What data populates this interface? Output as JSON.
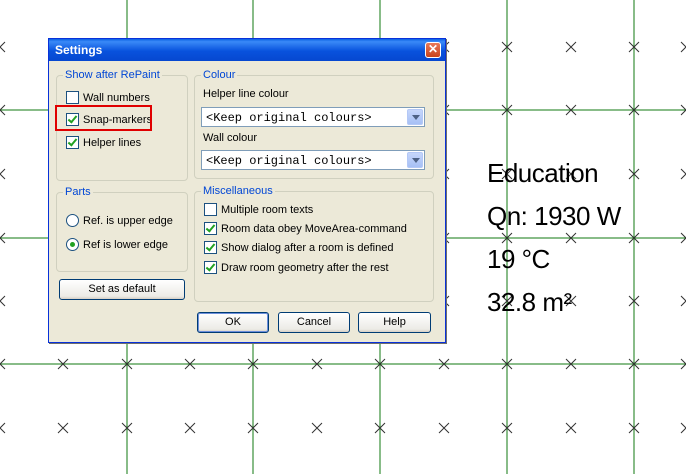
{
  "dialog": {
    "title": "Settings",
    "close_glyph": "✕",
    "show_after_repaint": {
      "legend": "Show after RePaint",
      "items": [
        {
          "label": "Wall numbers",
          "checked": false
        },
        {
          "label": "Snap-markers",
          "checked": true
        },
        {
          "label": "Helper lines",
          "checked": true
        }
      ]
    },
    "parts": {
      "legend": "Parts",
      "options": [
        {
          "label": "Ref. is upper edge",
          "selected": false
        },
        {
          "label": "Ref is lower edge",
          "selected": true
        }
      ]
    },
    "set_default_label": "Set as default",
    "colour": {
      "legend": "Colour",
      "helper_label": "Helper line colour",
      "helper_value": "<Keep original colours>",
      "wall_label": "Wall colour",
      "wall_value": "<Keep original colours>"
    },
    "misc": {
      "legend": "Miscellaneous",
      "items": [
        {
          "label": "Multiple room texts",
          "checked": false
        },
        {
          "label": "Room data obey MoveArea-command",
          "checked": true
        },
        {
          "label": "Show dialog after a room is defined",
          "checked": true
        },
        {
          "label": "Draw room geometry after the rest",
          "checked": true
        }
      ]
    },
    "buttons": {
      "ok": "OK",
      "cancel": "Cancel",
      "help": "Help"
    }
  },
  "room": {
    "name": "Education",
    "load": "Qn: 1930 W",
    "temperature": "19 °C",
    "area": "32.8 m²"
  },
  "colors": {
    "grid_line": "#117a11",
    "highlight": "#e00000",
    "legend_text": "#0046d5"
  },
  "icons": {
    "marker": "x-snap-marker-icon"
  }
}
